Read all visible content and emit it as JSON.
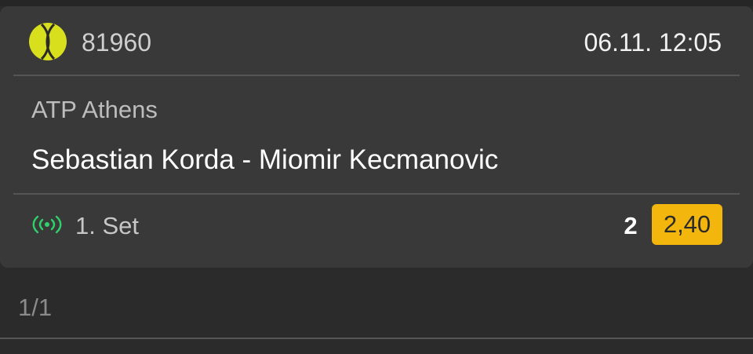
{
  "event": {
    "sport_icon": "tennis-ball-icon",
    "id": "81960",
    "datetime": "06.11. 12:05",
    "league": "ATP Athens",
    "match": "Sebastian Korda - Miomir Kecmanovic"
  },
  "market": {
    "live_icon": "live-broadcast-icon",
    "period": "1. Set",
    "selection": "2",
    "odds": "2,40"
  },
  "pager": {
    "text": "1/1"
  },
  "colors": {
    "background": "#2b2b2b",
    "card": "#393939",
    "odds_accent": "#f2b60d",
    "live_green": "#2fd26a",
    "ball_yellow": "#d8df1d"
  }
}
